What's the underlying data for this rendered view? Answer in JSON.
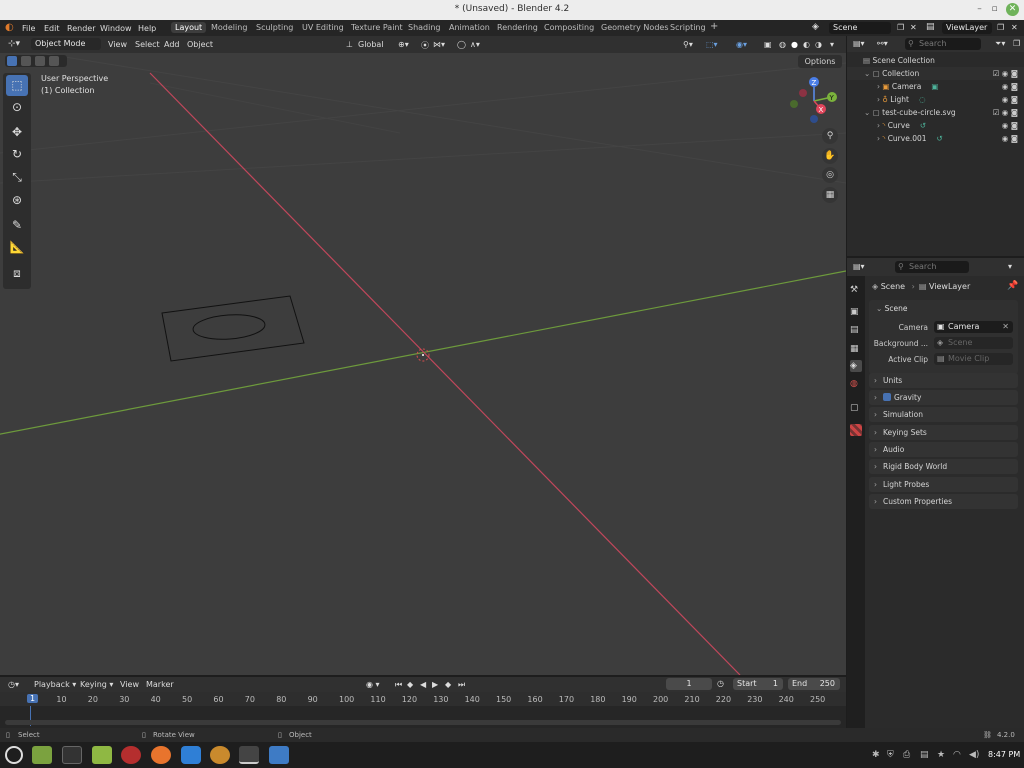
{
  "window": {
    "title": "* (Unsaved) - Blender 4.2"
  },
  "topbar": {
    "menus": [
      "File",
      "Edit",
      "Render",
      "Window",
      "Help"
    ],
    "workspaces": [
      "Layout",
      "Modeling",
      "Sculpting",
      "UV Editing",
      "Texture Paint",
      "Shading",
      "Animation",
      "Rendering",
      "Compositing",
      "Geometry Nodes",
      "Scripting"
    ],
    "scene": "Scene",
    "view_layer": "ViewLayer"
  },
  "viewport_header": {
    "mode": "Object Mode",
    "menus": [
      "View",
      "Select",
      "Add",
      "Object"
    ],
    "orientation": "Global",
    "options": "Options"
  },
  "viewport": {
    "perspective": "User Perspective",
    "collection": "(1) Collection"
  },
  "gizmo": {
    "z": "Z",
    "y": "Y",
    "x": "X"
  },
  "outliner": {
    "search_placeholder": "Search",
    "root": "Scene Collection",
    "items": [
      {
        "name": "Collection"
      },
      {
        "name": "Camera"
      },
      {
        "name": "Light"
      },
      {
        "name": "test-cube-circle.svg"
      },
      {
        "name": "Curve"
      },
      {
        "name": "Curve.001"
      }
    ]
  },
  "properties": {
    "search_placeholder": "Search",
    "breadcrumb_scene": "Scene",
    "breadcrumb_layer": "ViewLayer",
    "section_scene": "Scene",
    "camera_label": "Camera",
    "camera_value": "Camera",
    "background_label": "Background ...",
    "background_value": "Scene",
    "clip_label": "Active Clip",
    "clip_value": "Movie Clip",
    "sections": [
      "Units",
      "Gravity",
      "Simulation",
      "Keying Sets",
      "Audio",
      "Rigid Body World",
      "Light Probes",
      "Custom Properties"
    ]
  },
  "timeline": {
    "menus": [
      "Playback",
      "Keying",
      "View",
      "Marker"
    ],
    "current_frame": "1",
    "start_label": "Start",
    "start": "1",
    "end_label": "End",
    "end": "250",
    "ticks": [
      "1",
      "10",
      "20",
      "30",
      "40",
      "50",
      "60",
      "70",
      "80",
      "90",
      "100",
      "110",
      "120",
      "130",
      "140",
      "150",
      "160",
      "170",
      "180",
      "190",
      "200",
      "210",
      "220",
      "230",
      "240",
      "250"
    ]
  },
  "statusbar": {
    "select": "Select",
    "rotate": "Rotate View",
    "object": "Object",
    "version": "4.2.0"
  },
  "taskbar": {
    "time": "8:47 PM"
  },
  "colors": {
    "accent": "#4772b3",
    "x_axis": "#c0475b",
    "y_axis": "#6d9a3c",
    "viewport_bg": "#3d3d3d"
  }
}
